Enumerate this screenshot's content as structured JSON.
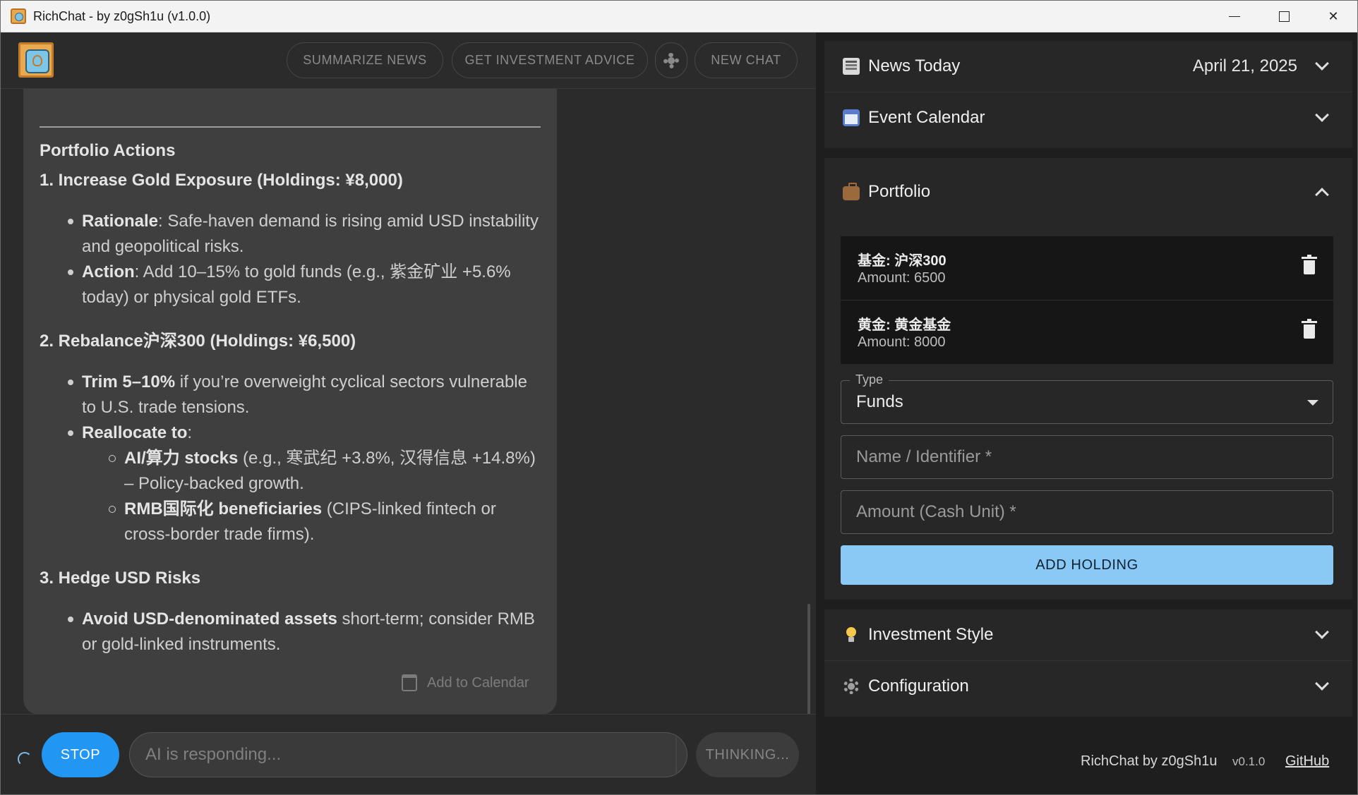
{
  "window": {
    "title": "RichChat - by z0gSh1u (v1.0.0)"
  },
  "toolbar": {
    "summarize": "SUMMARIZE NEWS",
    "advice": "GET INVESTMENT ADVICE",
    "new_chat": "NEW CHAT"
  },
  "message": {
    "heading": "Portfolio Actions",
    "s1": {
      "title": "1. Increase Gold Exposure (Holdings: ¥8,000)",
      "b1_bold": "Rationale",
      "b1_text": ": Safe-haven demand is rising amid USD instability",
      "b1_cont": "and geopolitical risks.",
      "b2_bold": "Action",
      "b2_text": ": Add 10–15% to gold funds (e.g., 紫金矿业 +5.6%",
      "b2_cont": "today) or physical gold ETFs."
    },
    "s2": {
      "title": "2. Rebalance沪深300 (Holdings: ¥6,500)",
      "b1_bold": "Trim 5–10%",
      "b1_text": " if you’re overweight cyclical sectors vulnerable",
      "b1_cont": "to U.S. trade tensions.",
      "b2_bold": "Reallocate to",
      "b2_text": ":",
      "sub1_bold": "AI/算力 stocks",
      "sub1_text": " (e.g., 寒武纪 +3.8%, 汉得信息 +14.8%)",
      "sub1_cont": "– Policy-backed growth.",
      "sub2_bold": "RMB国际化 beneficiaries",
      "sub2_text": " (CIPS-linked fintech or",
      "sub2_cont": "cross-border trade firms)."
    },
    "s3": {
      "title": "3. Hedge USD Risks",
      "b1_bold": "Avoid USD-denominated assets",
      "b1_text": " short-term; consider RMB",
      "b1_cont": "or gold-linked instruments."
    },
    "add_to_calendar": "Add to Calendar"
  },
  "input": {
    "stop": "STOP",
    "placeholder": "AI is responding...",
    "thinking": "THINKING..."
  },
  "sidebar": {
    "news": {
      "label": "News Today",
      "date": "April 21, 2025"
    },
    "calendar": {
      "label": "Event Calendar"
    },
    "portfolio": {
      "label": "Portfolio",
      "holdings": [
        {
          "name": "基金: 沪深300",
          "amount": "Amount: 6500"
        },
        {
          "name": "黄金: 黄金基金",
          "amount": "Amount: 8000"
        }
      ],
      "type_label": "Type",
      "type_value": "Funds",
      "name_placeholder": "Name / Identifier *",
      "amount_placeholder": "Amount (Cash Unit) *",
      "add_button": "ADD HOLDING"
    },
    "style": {
      "label": "Investment Style"
    },
    "config": {
      "label": "Configuration"
    }
  },
  "footer": {
    "app": "RichChat by z0gSh1u",
    "version": "v0.1.0",
    "github": "GitHub"
  },
  "colors": {
    "accent": "#2196f3",
    "add_button": "#8ac8f5"
  }
}
